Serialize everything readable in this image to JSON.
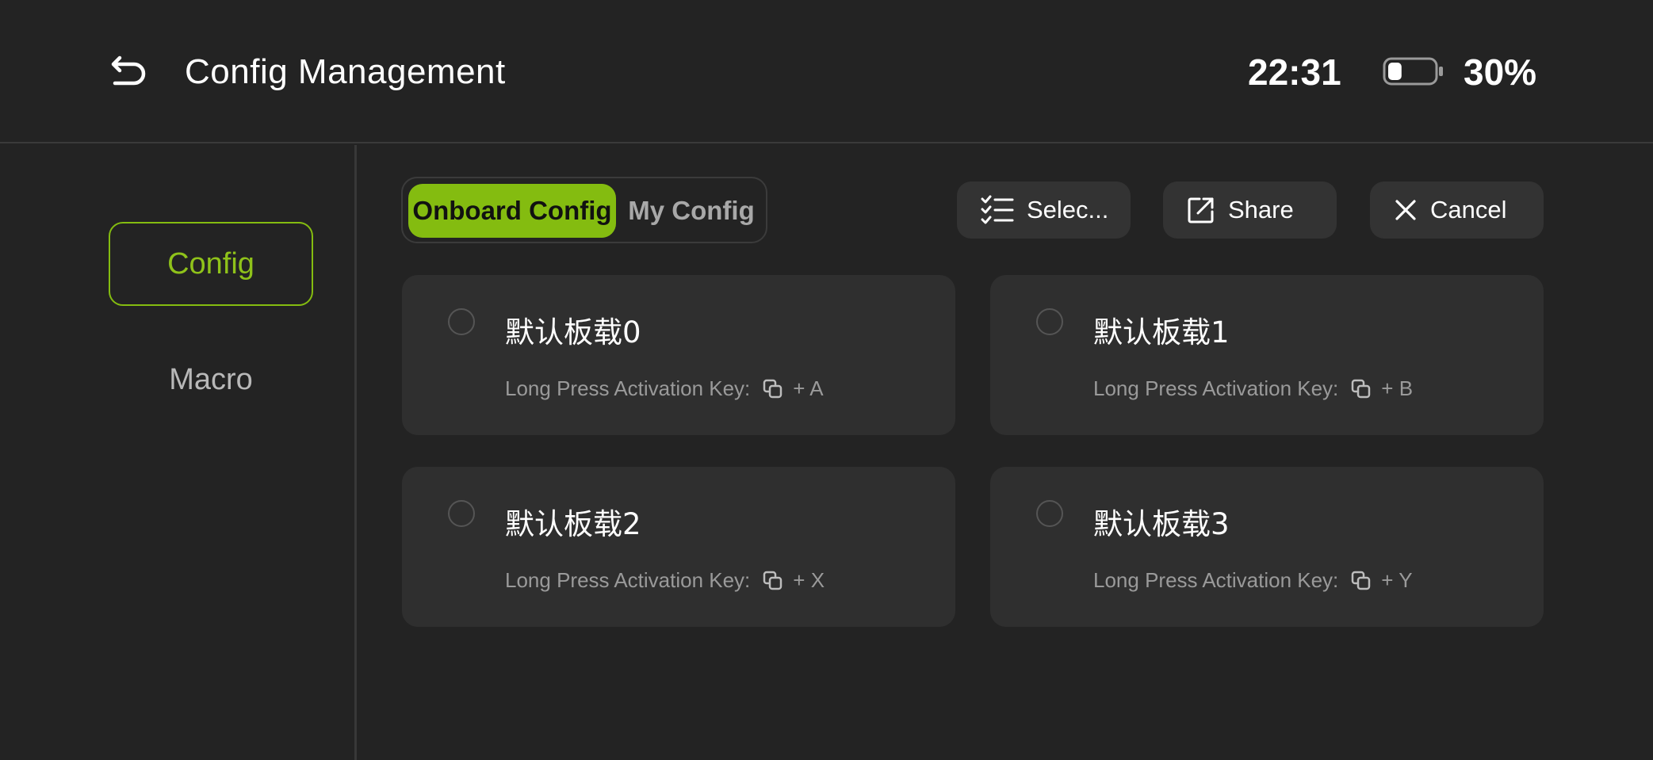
{
  "header": {
    "back_icon": "return-icon",
    "title": "Config Management",
    "time": "22:31",
    "battery_icon": "battery-icon",
    "battery_level": 0.3,
    "battery_text": "30%"
  },
  "sidebar": {
    "items": [
      {
        "label": "Config",
        "active": true
      },
      {
        "label": "Macro",
        "active": false
      }
    ]
  },
  "tabs": {
    "items": [
      {
        "label": "Onboard Config",
        "active": true
      },
      {
        "label": "My Config",
        "active": false
      }
    ]
  },
  "toolbar": {
    "select": {
      "label": "Selec...",
      "icon": "checklist-icon"
    },
    "share": {
      "label": "Share",
      "icon": "share-icon"
    },
    "cancel": {
      "label": "Cancel",
      "icon": "close-icon"
    }
  },
  "configs": [
    {
      "name": "默认板载0",
      "hotkey_label": "Long Press Activation Key:",
      "hotkey_icon": "copy-icon",
      "hotkey_combo": "+ A",
      "selected": false
    },
    {
      "name": "默认板载1",
      "hotkey_label": "Long Press Activation Key:",
      "hotkey_icon": "copy-icon",
      "hotkey_combo": "+ B",
      "selected": false
    },
    {
      "name": "默认板载2",
      "hotkey_label": "Long Press Activation Key:",
      "hotkey_icon": "copy-icon",
      "hotkey_combo": "+ X",
      "selected": false
    },
    {
      "name": "默认板载3",
      "hotkey_label": "Long Press Activation Key:",
      "hotkey_icon": "copy-icon",
      "hotkey_combo": "+ Y",
      "selected": false
    }
  ],
  "colors": {
    "accent": "#84bc10",
    "background": "#232323",
    "card": "#2f2f2f",
    "button": "#333333"
  }
}
